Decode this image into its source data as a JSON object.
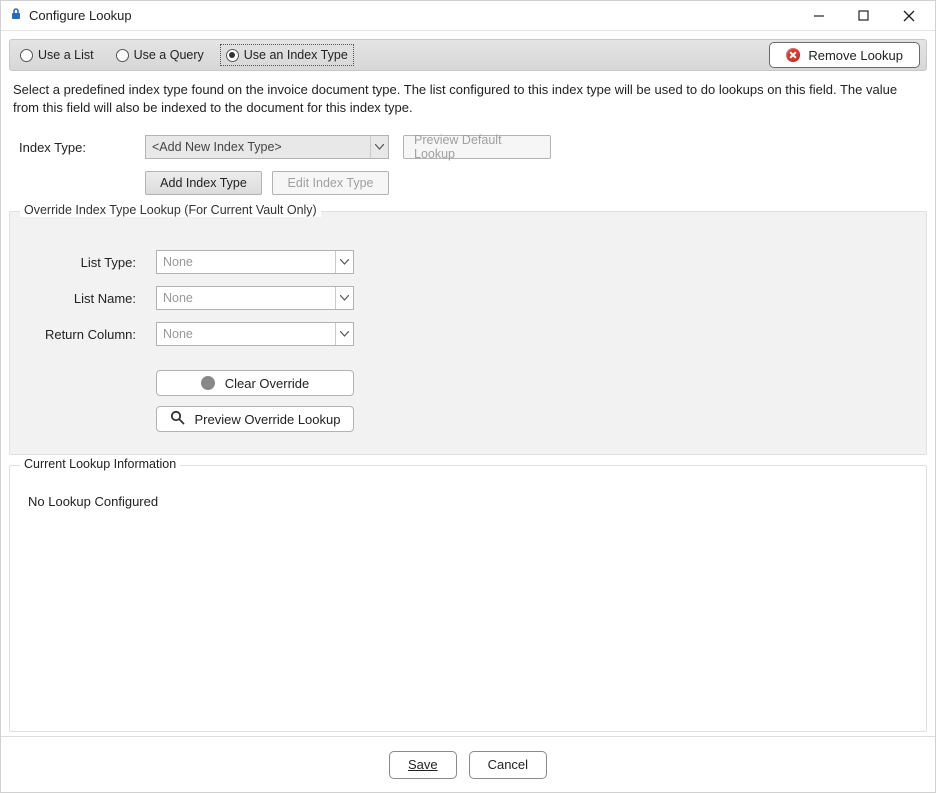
{
  "window": {
    "title": "Configure Lookup"
  },
  "radio": {
    "use_list": "Use a List",
    "use_query": "Use a Query",
    "use_index_type": "Use an Index Type",
    "selected": "use_index_type"
  },
  "remove_lookup_label": "Remove Lookup",
  "description": "Select a predefined index type found on the invoice document type. The list configured to this index type will be used to do lookups on this field. The value from this field will also be indexed to the document for this index type.",
  "index_type": {
    "label": "Index Type:",
    "value": "<Add New Index Type>",
    "add_button": "Add Index Type",
    "edit_button": "Edit Index Type",
    "preview_button": "Preview Default Lookup"
  },
  "override": {
    "legend": "Override Index Type Lookup (For Current Vault Only)",
    "list_type_label": "List Type:",
    "list_type_value": "None",
    "list_name_label": "List Name:",
    "list_name_value": "None",
    "return_col_label": "Return Column:",
    "return_col_value": "None",
    "clear_button": "Clear Override",
    "preview_button": "Preview Override Lookup"
  },
  "current_info": {
    "legend": "Current Lookup Information",
    "text": "No Lookup Configured"
  },
  "footer": {
    "save": "Save",
    "cancel": "Cancel"
  }
}
